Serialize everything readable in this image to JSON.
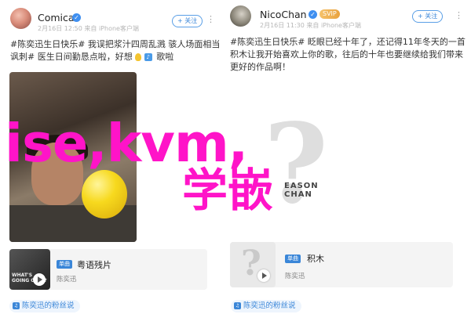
{
  "left_post": {
    "username": "Comical",
    "meta": "2月16日 12:50 来自 iPhone客户端",
    "follow_label": "+ 关注",
    "text_parts": [
      "#陈奕迅生日快乐# 我误把浆汁四周乱溅 骇人场面相当讽刺# 医生日间勤恳点啦，好想",
      "歌啦"
    ],
    "music": {
      "tag": "单曲",
      "title": "粤语残片",
      "artist": "陈奕迅",
      "cover_text": "WHAT'S GOING ON...?"
    },
    "fan_label": "陈奕迅的粉丝说"
  },
  "right_post": {
    "username": "NicoChan",
    "svip": "SVIP",
    "meta": "2月16日 11:30 来自 iPhone客户端",
    "follow_label": "+ 关注",
    "text": "#陈奕迅生日快乐# 眨眼已经十年了，还记得11年冬天的一首积木让我开始喜欢上你的歌，往后的十年也要继续给我们带来更好的作品啊！",
    "cover_text": "EASON CHAN",
    "music": {
      "tag": "单曲",
      "title": "积木",
      "artist": "陈奕迅"
    },
    "fan_label": "陈奕迅的粉丝说"
  },
  "watermark": {
    "line1": "ise,kvm,",
    "line2": "学嵌"
  },
  "icons": {
    "verified": "verified-icon",
    "more": "more-icon",
    "play": "play-icon",
    "bulb": "bulb-icon"
  },
  "colors": {
    "accent": "#3a86d8",
    "watermark": "#ff14c8",
    "svip": "#e9a23e"
  }
}
